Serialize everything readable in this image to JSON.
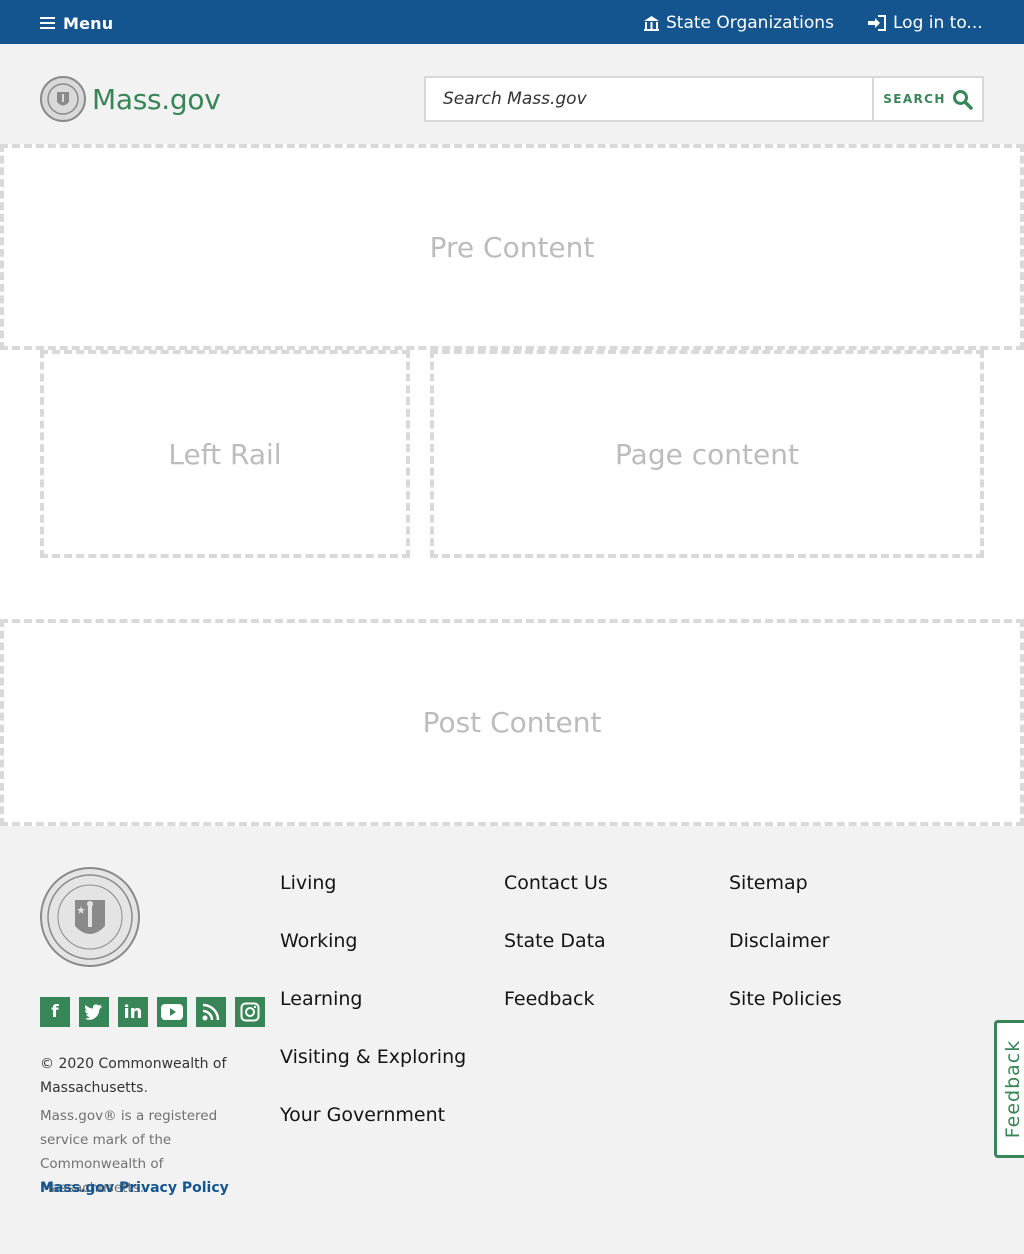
{
  "topbar": {
    "menu_label": "Menu",
    "state_orgs_label": "State Organizations",
    "login_label": "Log in to..."
  },
  "header": {
    "logo_text": "Mass.gov",
    "search_placeholder": "Search Mass.gov",
    "search_button_label": "SEARCH"
  },
  "regions": {
    "pre_content": "Pre Content",
    "left_rail": "Left Rail",
    "page_content": "Page content",
    "post_content": "Post Content"
  },
  "footer": {
    "social_icons": [
      "facebook-icon",
      "twitter-icon",
      "linkedin-icon",
      "youtube-icon",
      "rss-icon",
      "instagram-icon"
    ],
    "copyright_prefix": "© 2020 Commonwealth of Massachusetts",
    "copyright_suffix": ".",
    "servicemark": "Mass.gov® is a registered service mark of the Commonwealth of Massachusetts.",
    "privacy_link": "Mass.gov Privacy Policy",
    "col1": [
      "Living",
      "Working",
      "Learning",
      "Visiting & Exploring",
      "Your Government"
    ],
    "col2": [
      "Contact Us",
      "State Data",
      "Feedback"
    ],
    "col3": [
      "Sitemap",
      "Disclaimer",
      "Site Policies"
    ]
  },
  "feedback_tab_label": "Feedback",
  "colors": {
    "topbar_bg": "#14558f",
    "brand_green": "#388557",
    "footer_bg": "#f2f2f2",
    "placeholder_border": "#d9d9d9"
  }
}
